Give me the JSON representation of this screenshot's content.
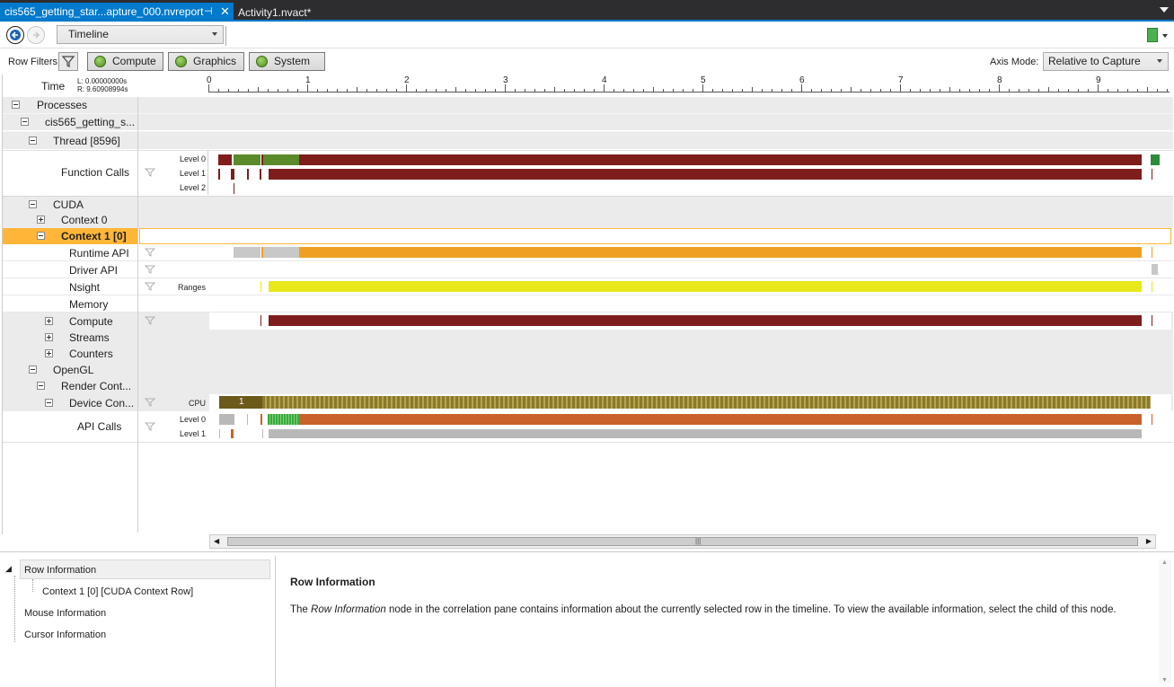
{
  "tabs": [
    {
      "label": "cis565_getting_star...apture_000.nvreport",
      "active": true
    },
    {
      "label": "Activity1.nvact*",
      "active": false
    }
  ],
  "toolbar": {
    "view_combo": "Timeline"
  },
  "filters": {
    "label": "Row Filters",
    "buttons": [
      "Compute",
      "Graphics",
      "System"
    ],
    "axis_mode_label": "Axis Mode:",
    "axis_mode_value": "Relative to Capture"
  },
  "timeline": {
    "time_label": "Time",
    "left_time": "L: 0.00000000s",
    "right_time": "R: 9.60908994s",
    "ticks": [
      "0",
      "1",
      "2",
      "3",
      "4",
      "5",
      "6",
      "7",
      "8",
      "9"
    ],
    "rows": {
      "processes": "Processes",
      "process": "cis565_getting_s...",
      "thread": "Thread [8596]",
      "function_calls": "Function Calls",
      "cuda": "CUDA",
      "context0": "Context 0",
      "context1": "Context 1 [0]",
      "runtime_api": "Runtime API",
      "driver_api": "Driver API",
      "nsight": "Nsight",
      "memory": "Memory",
      "compute": "Compute",
      "streams": "Streams",
      "counters": "Counters",
      "opengl": "OpenGL",
      "render_context": "Render Cont...",
      "device_context": "Device Con...",
      "api_calls": "API Calls"
    },
    "sublabels": {
      "level0": "Level 0",
      "level1": "Level 1",
      "level2": "Level 2",
      "ranges": "Ranges",
      "cpu": "CPU",
      "cpu_value": "1"
    }
  },
  "bottom": {
    "tree": {
      "row_information": "Row Information",
      "context_row": "Context 1 [0] [CUDA Context Row]",
      "mouse_information": "Mouse Information",
      "cursor_information": "Cursor Information"
    },
    "info": {
      "title": "Row Information",
      "text_prefix": "The ",
      "text_italic": "Row Information",
      "text_suffix": " node in the correlation pane contains information about the currently selected row in the timeline. To view the available information, select the child of this node."
    }
  },
  "colors": {
    "accent": "#007acc",
    "selection": "#ffb638",
    "fn_red": "#7f1d1d",
    "fn_green": "#5a8a2a",
    "runtime_orange": "#f0a020",
    "nsight_yellow": "#e8e81a",
    "api_orange": "#c8622a",
    "cpu_olive": "#8a7a2c"
  }
}
